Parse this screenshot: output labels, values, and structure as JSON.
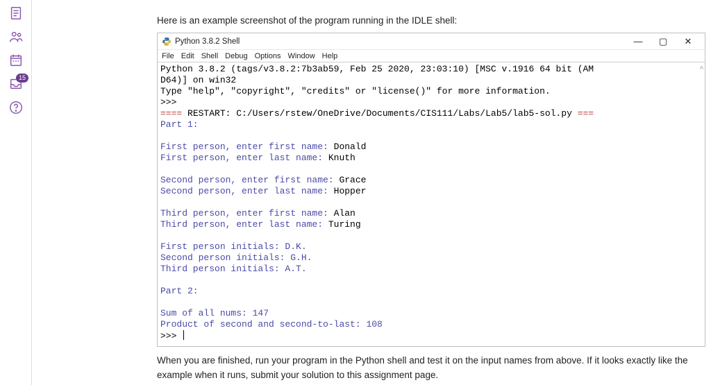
{
  "sidebar": {
    "badge_count": "15"
  },
  "intro": "Here is an example screenshot of the program running in the IDLE shell:",
  "outro": "When you are finished, run your program in the Python shell and test it on the input names from above. If it looks exactly like the example when it runs, submit your solution to this assignment page.",
  "window": {
    "title": "Python 3.8.2 Shell",
    "menus": [
      "File",
      "Edit",
      "Shell",
      "Debug",
      "Options",
      "Window",
      "Help"
    ],
    "btn_min": "—",
    "btn_max": "▢",
    "btn_close": "✕"
  },
  "shell": {
    "line1": "Python 3.8.2 (tags/v3.8.2:7b3ab59, Feb 25 2020, 23:03:10) [MSC v.1916 64 bit (AM",
    "line2": "D64)] on win32",
    "line3a": "Type \"help\", \"copyright\", \"credits\" or \"license()\" for more information.",
    "prompt1": ">>>",
    "restart_prefix": "==== ",
    "restart_label": "RESTART: C:/Users/rstew/OneDrive/Documents/CIS111/Labs/Lab5/lab5-sol.py",
    "restart_suffix": " ===",
    "part1": "Part 1:",
    "p1a": "First person, enter first name:",
    "p1a_in": " Donald",
    "p1b": "First person, enter last name:",
    "p1b_in": " Knuth",
    "p2a": "Second person, enter first name:",
    "p2a_in": " Grace",
    "p2b": "Second person, enter last name:",
    "p2b_in": " Hopper",
    "p3a": "Third person, enter first name:",
    "p3a_in": " Alan",
    "p3b": "Third person, enter last name:",
    "p3b_in": " Turing",
    "i1": "First person initials: D.K.",
    "i2": "Second person initials: G.H.",
    "i3": "Third person initials: A.T.",
    "part2": "Part 2:",
    "sum": "Sum of all nums: 147",
    "prod": "Product of second and second-to-last: 108",
    "prompt2": ">>> "
  }
}
